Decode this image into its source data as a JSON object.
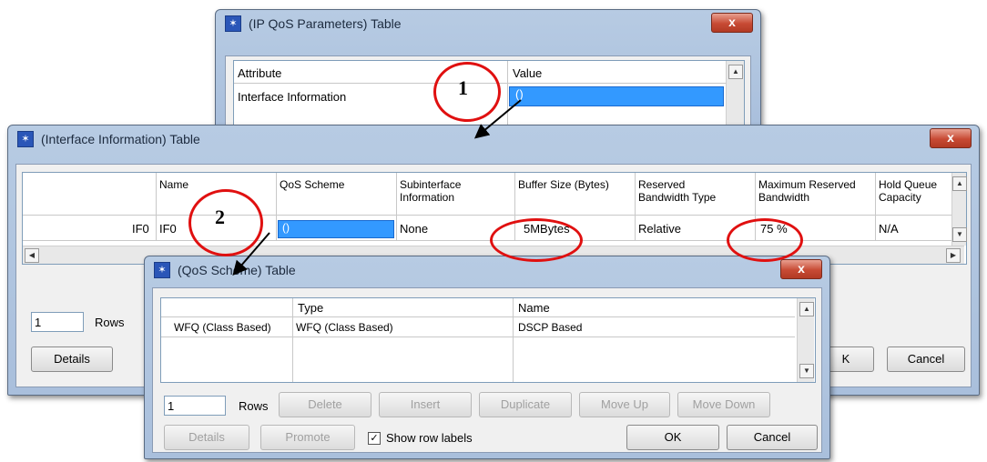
{
  "ip_qos_window": {
    "title": "(IP QoS Parameters) Table",
    "close": "x",
    "columns": [
      "Attribute",
      "Value"
    ],
    "rows": [
      {
        "attribute": "Interface Information",
        "value": "()"
      }
    ]
  },
  "interface_window": {
    "title": "(Interface Information) Table",
    "close": "x",
    "columns": [
      "Name",
      "QoS Scheme",
      "Subinterface\nInformation",
      "Buffer Size (Bytes)",
      "Reserved\nBandwidth Type",
      "Maximum Reserved\nBandwidth",
      "Hold Queue\nCapacity"
    ],
    "row": {
      "label": "IF0",
      "name": "IF0",
      "qos_scheme": "()",
      "subinterface": "None",
      "buffer_size": "5MBytes",
      "bandwidth_type": "Relative",
      "max_bandwidth": "75 %",
      "hold_queue": "N/A"
    },
    "rows_value": "1",
    "rows_label": "Rows",
    "details_label": "Details",
    "ok_label": "K",
    "cancel_label": "Cancel"
  },
  "qos_scheme_window": {
    "title": "(QoS Scheme) Table",
    "close": "x",
    "columns": [
      "Type",
      "Name"
    ],
    "row": {
      "label": "WFQ (Class Based)",
      "type": "WFQ (Class Based)",
      "name": "DSCP Based"
    },
    "rows_value": "1",
    "rows_label": "Rows",
    "buttons": {
      "delete": "Delete",
      "insert": "Insert",
      "duplicate": "Duplicate",
      "move_up": "Move Up",
      "move_down": "Move Down"
    },
    "details_label": "Details",
    "promote_label": "Promote",
    "show_row_labels": "Show row labels",
    "ok_label": "OK",
    "cancel_label": "Cancel"
  },
  "annotations": {
    "step1": "1",
    "step2": "2"
  }
}
